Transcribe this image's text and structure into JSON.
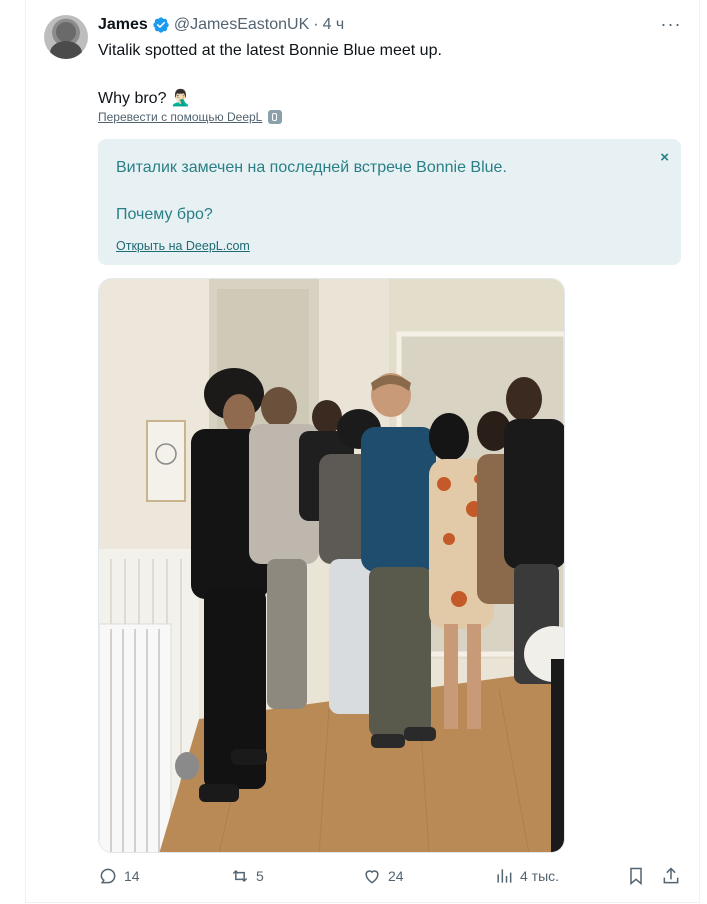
{
  "tweet": {
    "author_name": "James",
    "handle": "@JamesEastonUK",
    "separator": "·",
    "time": "4 ч",
    "more_label": "···",
    "text_line1": "Vitalik spotted at the latest Bonnie Blue meet up.",
    "text_line2": "Why bro? 🤦🏻‍♂️",
    "translate_link": "Перевести с помощью DeepL"
  },
  "translation": {
    "line1": "Виталик замечен на последней встрече Bonnie Blue.",
    "line2": "Почему бро?",
    "open_link": "Открыть на DeepL.com",
    "close_label": "×"
  },
  "actions": {
    "replies": "14",
    "reposts": "5",
    "likes": "24",
    "views": "4 тыс."
  },
  "colors": {
    "verified": "#1d9bf0",
    "muted": "#536471",
    "translation_bg": "#e7f1f3",
    "translation_text": "#2a7f86"
  },
  "icons": {
    "reply": "reply-icon",
    "repost": "repost-icon",
    "like": "heart-icon",
    "views": "views-icon",
    "bookmark": "bookmark-icon",
    "share": "share-icon"
  }
}
